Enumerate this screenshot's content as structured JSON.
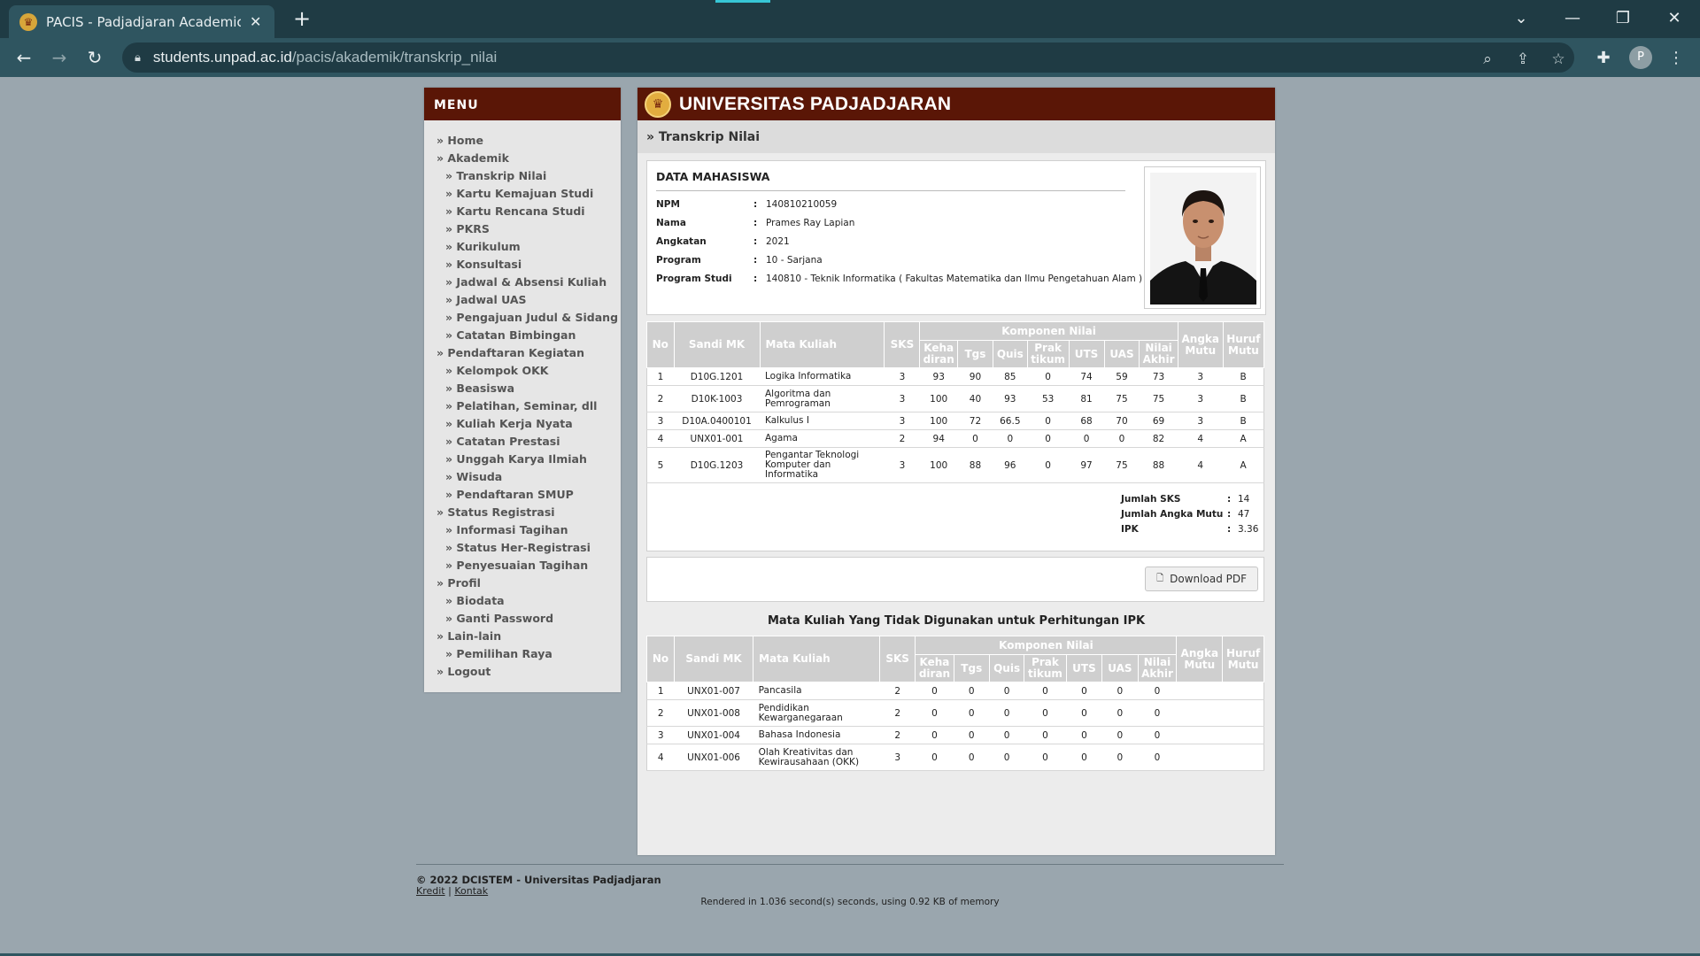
{
  "browser": {
    "tab_title": "PACIS - Padjadjaran Academics Ir",
    "url_host": "students.unpad.ac.id",
    "url_path": "/pacis/akademik/transkrip_nilai",
    "profile_initial": "P",
    "icons": [
      "back-icon",
      "forward-icon",
      "reload-icon",
      "lock-icon",
      "zoom-icon",
      "share-icon",
      "star-icon",
      "extensions-icon",
      "menu-icon"
    ]
  },
  "menu": {
    "header": "MENU",
    "items": [
      {
        "label": "» Home",
        "sub": false
      },
      {
        "label": "» Akademik",
        "sub": false
      },
      {
        "label": "» Transkrip Nilai",
        "sub": true
      },
      {
        "label": "» Kartu Kemajuan Studi",
        "sub": true
      },
      {
        "label": "» Kartu Rencana Studi",
        "sub": true
      },
      {
        "label": "» PKRS",
        "sub": true
      },
      {
        "label": "» Kurikulum",
        "sub": true
      },
      {
        "label": "» Konsultasi",
        "sub": true
      },
      {
        "label": "» Jadwal & Absensi Kuliah",
        "sub": true
      },
      {
        "label": "» Jadwal UAS",
        "sub": true
      },
      {
        "label": "» Pengajuan Judul & Sidang",
        "sub": true
      },
      {
        "label": "» Catatan Bimbingan",
        "sub": true
      },
      {
        "label": "» Pendaftaran Kegiatan",
        "sub": false
      },
      {
        "label": "» Kelompok OKK",
        "sub": true
      },
      {
        "label": "» Beasiswa",
        "sub": true
      },
      {
        "label": "» Pelatihan, Seminar, dll",
        "sub": true
      },
      {
        "label": "» Kuliah Kerja Nyata",
        "sub": true
      },
      {
        "label": "» Catatan Prestasi",
        "sub": true
      },
      {
        "label": "» Unggah Karya Ilmiah",
        "sub": true
      },
      {
        "label": "» Wisuda",
        "sub": true
      },
      {
        "label": "» Pendaftaran SMUP",
        "sub": true
      },
      {
        "label": "» Status Registrasi",
        "sub": false
      },
      {
        "label": "» Informasi Tagihan",
        "sub": true
      },
      {
        "label": "» Status Her-Registrasi",
        "sub": true
      },
      {
        "label": "» Penyesuaian Tagihan",
        "sub": true
      },
      {
        "label": "» Profil",
        "sub": false
      },
      {
        "label": "» Biodata",
        "sub": true
      },
      {
        "label": "» Ganti Password",
        "sub": true
      },
      {
        "label": "» Lain-lain",
        "sub": false
      },
      {
        "label": "» Pemilihan Raya",
        "sub": true
      },
      {
        "label": "» Logout",
        "sub": false
      }
    ]
  },
  "header": {
    "title": "UNIVERSITAS PADJADJARAN",
    "subtitle": "» Transkrip Nilai"
  },
  "student": {
    "section_title": "DATA MAHASISWA",
    "fields": [
      {
        "label": "NPM",
        "value": "140810210059"
      },
      {
        "label": "Nama",
        "value": "Prames Ray Lapian"
      },
      {
        "label": "Angkatan",
        "value": "2021"
      },
      {
        "label": "Program",
        "value": "10 - Sarjana"
      },
      {
        "label": "Program Studi",
        "value": "140810 - Teknik Informatika ( Fakultas Matematika dan Ilmu Pengetahuan Alam )"
      }
    ]
  },
  "table_headers": {
    "no": "No",
    "code": "Sandi MK",
    "course": "Mata Kuliah",
    "sks": "SKS",
    "components": "Komponen Nilai",
    "kehadiran": "Keha diran",
    "tgs": "Tgs",
    "quis": "Quis",
    "praktikum": "Prak tikum",
    "uts": "UTS",
    "uas": "UAS",
    "nilai_akhir": "Nilai Akhir",
    "angka_mutu": "Angka Mutu",
    "huruf_mutu": "Huruf Mutu"
  },
  "grades": [
    {
      "no": "1",
      "code": "D10G.1201",
      "course": "Logika Informatika",
      "sks": "3",
      "kehadiran": "93",
      "tgs": "90",
      "quis": "85",
      "praktikum": "0",
      "uts": "74",
      "uas": "59",
      "nilai_akhir": "73",
      "angka_mutu": "3",
      "huruf_mutu": "B"
    },
    {
      "no": "2",
      "code": "D10K-1003",
      "course": "Algoritma dan Pemrograman",
      "sks": "3",
      "kehadiran": "100",
      "tgs": "40",
      "quis": "93",
      "praktikum": "53",
      "uts": "81",
      "uas": "75",
      "nilai_akhir": "75",
      "angka_mutu": "3",
      "huruf_mutu": "B"
    },
    {
      "no": "3",
      "code": "D10A.0400101",
      "course": "Kalkulus I",
      "sks": "3",
      "kehadiran": "100",
      "tgs": "72",
      "quis": "66.5",
      "praktikum": "0",
      "uts": "68",
      "uas": "70",
      "nilai_akhir": "69",
      "angka_mutu": "3",
      "huruf_mutu": "B"
    },
    {
      "no": "4",
      "code": "UNX01-001",
      "course": "Agama",
      "sks": "2",
      "kehadiran": "94",
      "tgs": "0",
      "quis": "0",
      "praktikum": "0",
      "uts": "0",
      "uas": "0",
      "nilai_akhir": "82",
      "angka_mutu": "4",
      "huruf_mutu": "A"
    },
    {
      "no": "5",
      "code": "D10G.1203",
      "course": "Pengantar Teknologi Komputer dan Informatika",
      "sks": "3",
      "kehadiran": "100",
      "tgs": "88",
      "quis": "96",
      "praktikum": "0",
      "uts": "97",
      "uas": "75",
      "nilai_akhir": "88",
      "angka_mutu": "4",
      "huruf_mutu": "A"
    }
  ],
  "summary": [
    {
      "label": "Jumlah SKS",
      "value": "14"
    },
    {
      "label": "Jumlah Angka Mutu",
      "value": "47"
    },
    {
      "label": "IPK",
      "value": "3.36"
    }
  ],
  "download_label": "Download PDF",
  "excluded_title": "Mata Kuliah Yang Tidak Digunakan untuk Perhitungan IPK",
  "excluded": [
    {
      "no": "1",
      "code": "UNX01-007",
      "course": "Pancasila",
      "sks": "2",
      "kehadiran": "0",
      "tgs": "0",
      "quis": "0",
      "praktikum": "0",
      "uts": "0",
      "uas": "0",
      "nilai_akhir": "0",
      "angka_mutu": "",
      "huruf_mutu": ""
    },
    {
      "no": "2",
      "code": "UNX01-008",
      "course": "Pendidikan Kewarganegaraan",
      "sks": "2",
      "kehadiran": "0",
      "tgs": "0",
      "quis": "0",
      "praktikum": "0",
      "uts": "0",
      "uas": "0",
      "nilai_akhir": "0",
      "angka_mutu": "",
      "huruf_mutu": ""
    },
    {
      "no": "3",
      "code": "UNX01-004",
      "course": "Bahasa Indonesia",
      "sks": "2",
      "kehadiran": "0",
      "tgs": "0",
      "quis": "0",
      "praktikum": "0",
      "uts": "0",
      "uas": "0",
      "nilai_akhir": "0",
      "angka_mutu": "",
      "huruf_mutu": ""
    },
    {
      "no": "4",
      "code": "UNX01-006",
      "course": "Olah Kreativitas dan Kewirausahaan (OKK)",
      "sks": "3",
      "kehadiran": "0",
      "tgs": "0",
      "quis": "0",
      "praktikum": "0",
      "uts": "0",
      "uas": "0",
      "nilai_akhir": "0",
      "angka_mutu": "",
      "huruf_mutu": ""
    }
  ],
  "footer": {
    "copyright": "© 2022 DCISTEM - Universitas Padjadjaran",
    "link_kredit": "Kredit",
    "link_separator": "|",
    "link_kontak": "Kontak",
    "render_note": "Rendered in 1.036 second(s) seconds, using 0.92 KB of memory"
  },
  "colors": {
    "brand_dark": "#5a1606",
    "page_bg": "#9aa6ae",
    "header_gray": "#cfcfcf",
    "chrome_dark": "#1f3b44"
  }
}
